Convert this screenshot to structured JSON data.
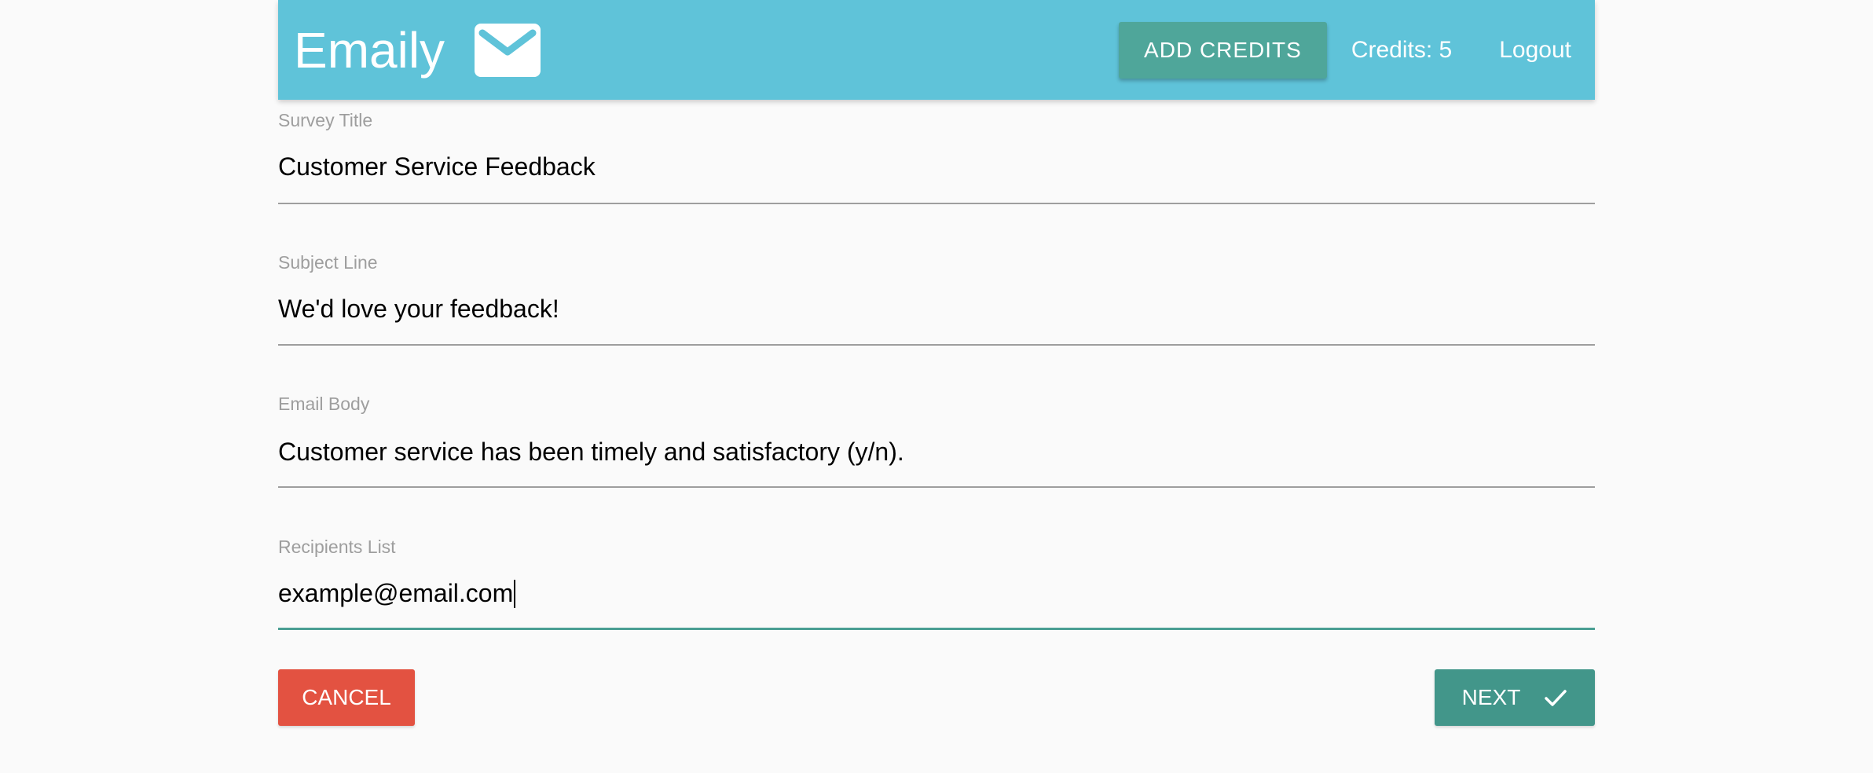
{
  "header": {
    "brand": "Emaily",
    "brand_icon": "mail-icon",
    "add_credits_label": "ADD CREDITS",
    "credits_text": "Credits: 5",
    "logout_label": "Logout",
    "bg_color": "#5fc3d9",
    "button_color": "#4fa69a"
  },
  "form": {
    "fields": [
      {
        "label": "Survey Title",
        "value": "Customer Service Feedback"
      },
      {
        "label": "Subject Line",
        "value": "We'd love your feedback!"
      },
      {
        "label": "Email Body",
        "value": "Customer service has been timely and satisfactory (y/n)."
      },
      {
        "label": "Recipients List",
        "value": "example@email.com"
      }
    ],
    "cancel_label": "CANCEL",
    "next_label": "NEXT",
    "next_icon": "check-icon",
    "cancel_color": "#e35241",
    "next_color": "#42968a"
  }
}
